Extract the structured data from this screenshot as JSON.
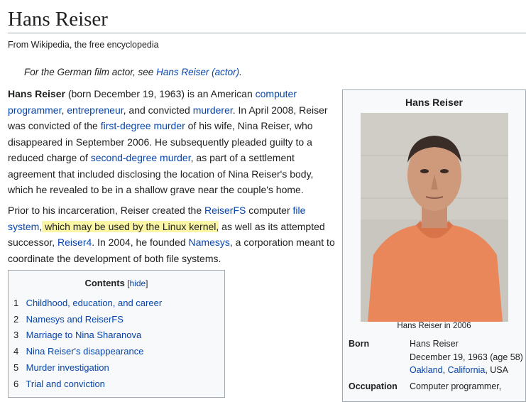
{
  "title": "Hans Reiser",
  "tagline": "From Wikipedia, the free encyclopedia",
  "hatnote": {
    "prefix": "For the German film actor, see ",
    "link": "Hans Reiser (actor)",
    "suffix": "."
  },
  "p1": {
    "s1": "Hans Reiser",
    "s2": " (born December 19, 1963) is an American ",
    "l1": "computer programmer",
    "s3": ", ",
    "l2": "entrepreneur",
    "s4": ", and convicted ",
    "l3": "murderer",
    "s5": ". In April 2008, Reiser was convicted of the ",
    "l4": "first-degree murder",
    "s6": " of his wife, Nina Reiser, who disappeared in September 2006. He subsequently pleaded guilty to a reduced charge of ",
    "l5": "second-degree murder",
    "s7": ", as part of a settlement agreement that included disclosing the location of Nina Reiser's body, which he revealed to be in a shallow grave near the couple's home."
  },
  "p2": {
    "s1": "Prior to his incarceration, Reiser created the ",
    "l1": "ReiserFS",
    "s2": " computer ",
    "l2": "file system",
    "s3": ",",
    "hl": " which may be used by the Linux kernel,",
    "s4": " as well as its attempted successor, ",
    "l3": "Reiser4",
    "s5": ". In 2004, he founded ",
    "l4": "Namesys",
    "s6": ", a corporation meant to coordinate the development of both file systems."
  },
  "toc": {
    "title": "Contents",
    "hide_open": " [",
    "hide": "hide",
    "hide_close": "]",
    "items": [
      {
        "num": "1",
        "label": "Childhood, education, and career"
      },
      {
        "num": "2",
        "label": "Namesys and ReiserFS"
      },
      {
        "num": "3",
        "label": "Marriage to Nina Sharanova"
      },
      {
        "num": "4",
        "label": "Nina Reiser's disappearance"
      },
      {
        "num": "5",
        "label": "Murder investigation"
      },
      {
        "num": "6",
        "label": "Trial and conviction"
      }
    ]
  },
  "infobox": {
    "name": "Hans Reiser",
    "caption": "Hans Reiser in 2006",
    "born_label": "Born",
    "born_name": "Hans Reiser",
    "born_date": "December 19, 1963 (age 58)",
    "born_city": "Oakland",
    "born_sep": ", ",
    "born_state": "California",
    "born_country": ", USA",
    "occupation_label": "Occupation",
    "occupation_value": "Computer programmer,"
  }
}
